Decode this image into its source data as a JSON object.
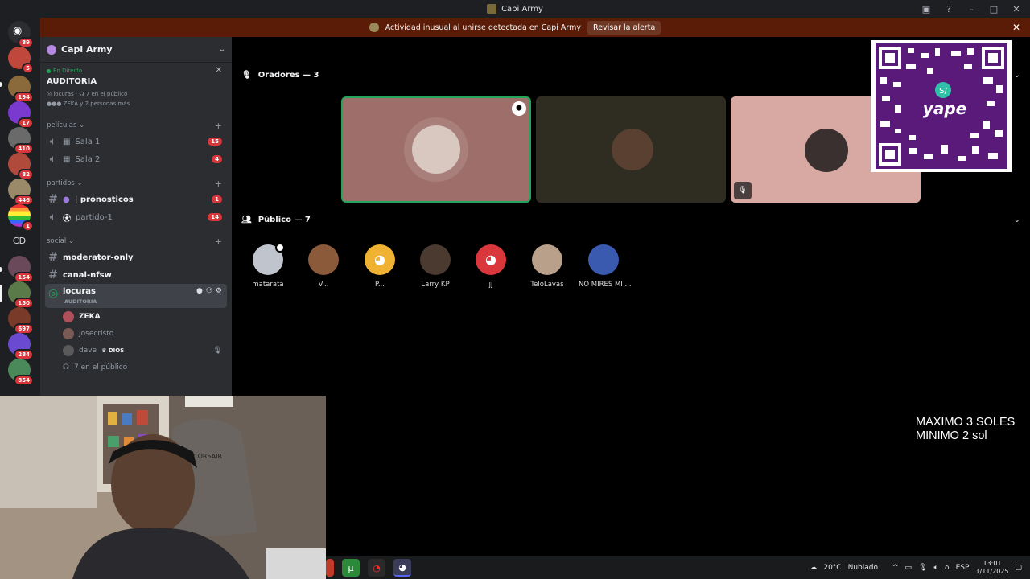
{
  "window": {
    "title": "Capi Army"
  },
  "alert": {
    "text": "Actividad inusual al unirse detectada en Capi Army",
    "button": "Revisar la alerta"
  },
  "guild_badges": [
    "89",
    "5",
    "194",
    "17",
    "410",
    "82",
    "446",
    "1",
    "154",
    "150",
    "697",
    "284",
    "854"
  ],
  "guild_text": "CD",
  "server": {
    "name": "Capi Army"
  },
  "live": {
    "tag": "En Directo",
    "title": "AUDITORIA",
    "channel": "locuras",
    "audience": "7 en el público",
    "speakers": "ZEKA y 2 personas más"
  },
  "categories": {
    "peliculas": {
      "label": "películas",
      "channels": [
        {
          "name": "Sala 1",
          "badge": "15"
        },
        {
          "name": "Sala 2",
          "badge": "4"
        }
      ]
    },
    "partidos": {
      "label": "partidos",
      "channels": [
        {
          "name": "| pronosticos",
          "badge": "1"
        },
        {
          "name": "partido-1",
          "badge": "14"
        }
      ]
    },
    "social": {
      "label": "social",
      "channels": [
        {
          "name": "moderator-only"
        },
        {
          "name": "canal-nfsw"
        },
        {
          "name": "locuras",
          "sub": "AUDITORIA"
        }
      ]
    }
  },
  "stage_users": [
    {
      "name": "ZEKA"
    },
    {
      "name": "Josecristo"
    },
    {
      "name": "dave",
      "role": "DIOS"
    }
  ],
  "audience_summary": "7 en el público",
  "stage": {
    "speakers_header": "Oradores — 3",
    "audience_header": "Público — 7",
    "audience": [
      "matarata",
      "V...",
      "P...",
      "Larry KP",
      "jj",
      "TeloLavas",
      "NO MIRES MI ..."
    ]
  },
  "overlay": {
    "line1": "MAXIMO 3 SOLES",
    "line2": "MINIMO 2 sol"
  },
  "taskbar": {
    "weather": "20°C",
    "condition": "Nublado",
    "lang": "ESP",
    "time": "13:01",
    "date": "1/11/2025"
  },
  "colors": {
    "accent": "#5865f2",
    "live": "#23a55a",
    "badge": "#da373c",
    "alert_bg": "#5a1c06"
  }
}
